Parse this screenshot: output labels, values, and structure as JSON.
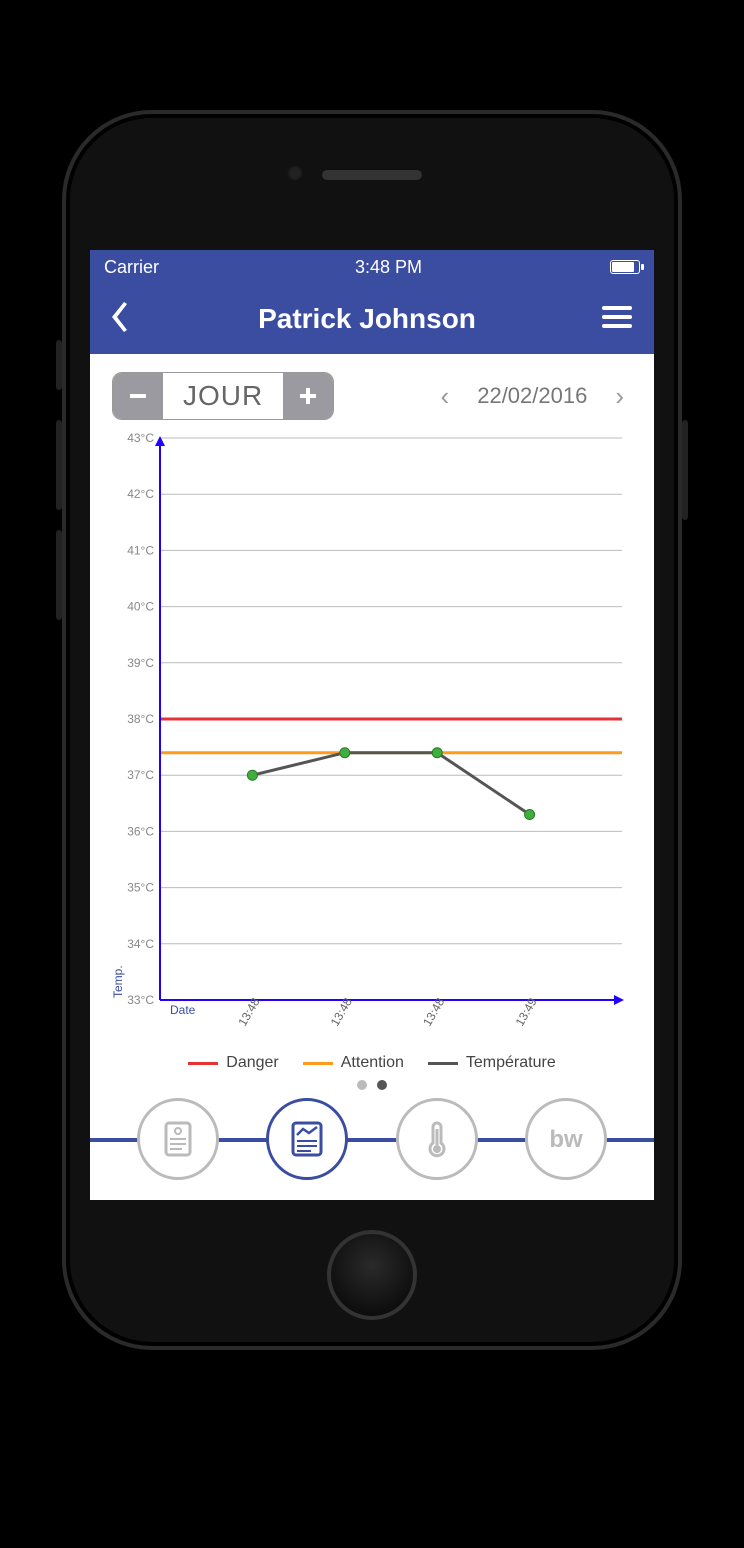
{
  "statusbar": {
    "carrier": "Carrier",
    "time": "3:48 PM"
  },
  "navbar": {
    "title": "Patrick Johnson"
  },
  "controls": {
    "range_label": "JOUR",
    "date": "22/02/2016"
  },
  "legend": {
    "danger": "Danger",
    "attention": "Attention",
    "temperature": "Température"
  },
  "axes": {
    "ylabel": "Temp.",
    "xlabel": "Date"
  },
  "pager": {
    "count": 2,
    "active_index": 1
  },
  "colors": {
    "primary": "#3a4da0",
    "danger": "#e63232",
    "attention": "#ff9a1a",
    "temp_line": "#555555",
    "point": "#3fae3f",
    "axis": "#2000ff"
  },
  "chart_data": {
    "type": "line",
    "title": "",
    "xlabel": "Date",
    "ylabel": "Temp.",
    "ylim": [
      33,
      43
    ],
    "yticks": [
      33,
      34,
      35,
      36,
      37,
      38,
      39,
      40,
      41,
      42,
      43
    ],
    "ytick_labels": [
      "33°C",
      "34°C",
      "35°C",
      "36°C",
      "37°C",
      "38°C",
      "39°C",
      "40°C",
      "41°C",
      "42°C",
      "43°C"
    ],
    "x": [
      "13:48",
      "13:48",
      "13:48",
      "13:49"
    ],
    "series": [
      {
        "name": "Température",
        "values": [
          37.0,
          37.4,
          37.4,
          36.3
        ],
        "color": "#555555",
        "points_color": "#3fae3f"
      }
    ],
    "thresholds": [
      {
        "name": "Danger",
        "value": 38.0,
        "color": "#e63232"
      },
      {
        "name": "Attention",
        "value": 37.4,
        "color": "#ff9a1a"
      }
    ]
  }
}
